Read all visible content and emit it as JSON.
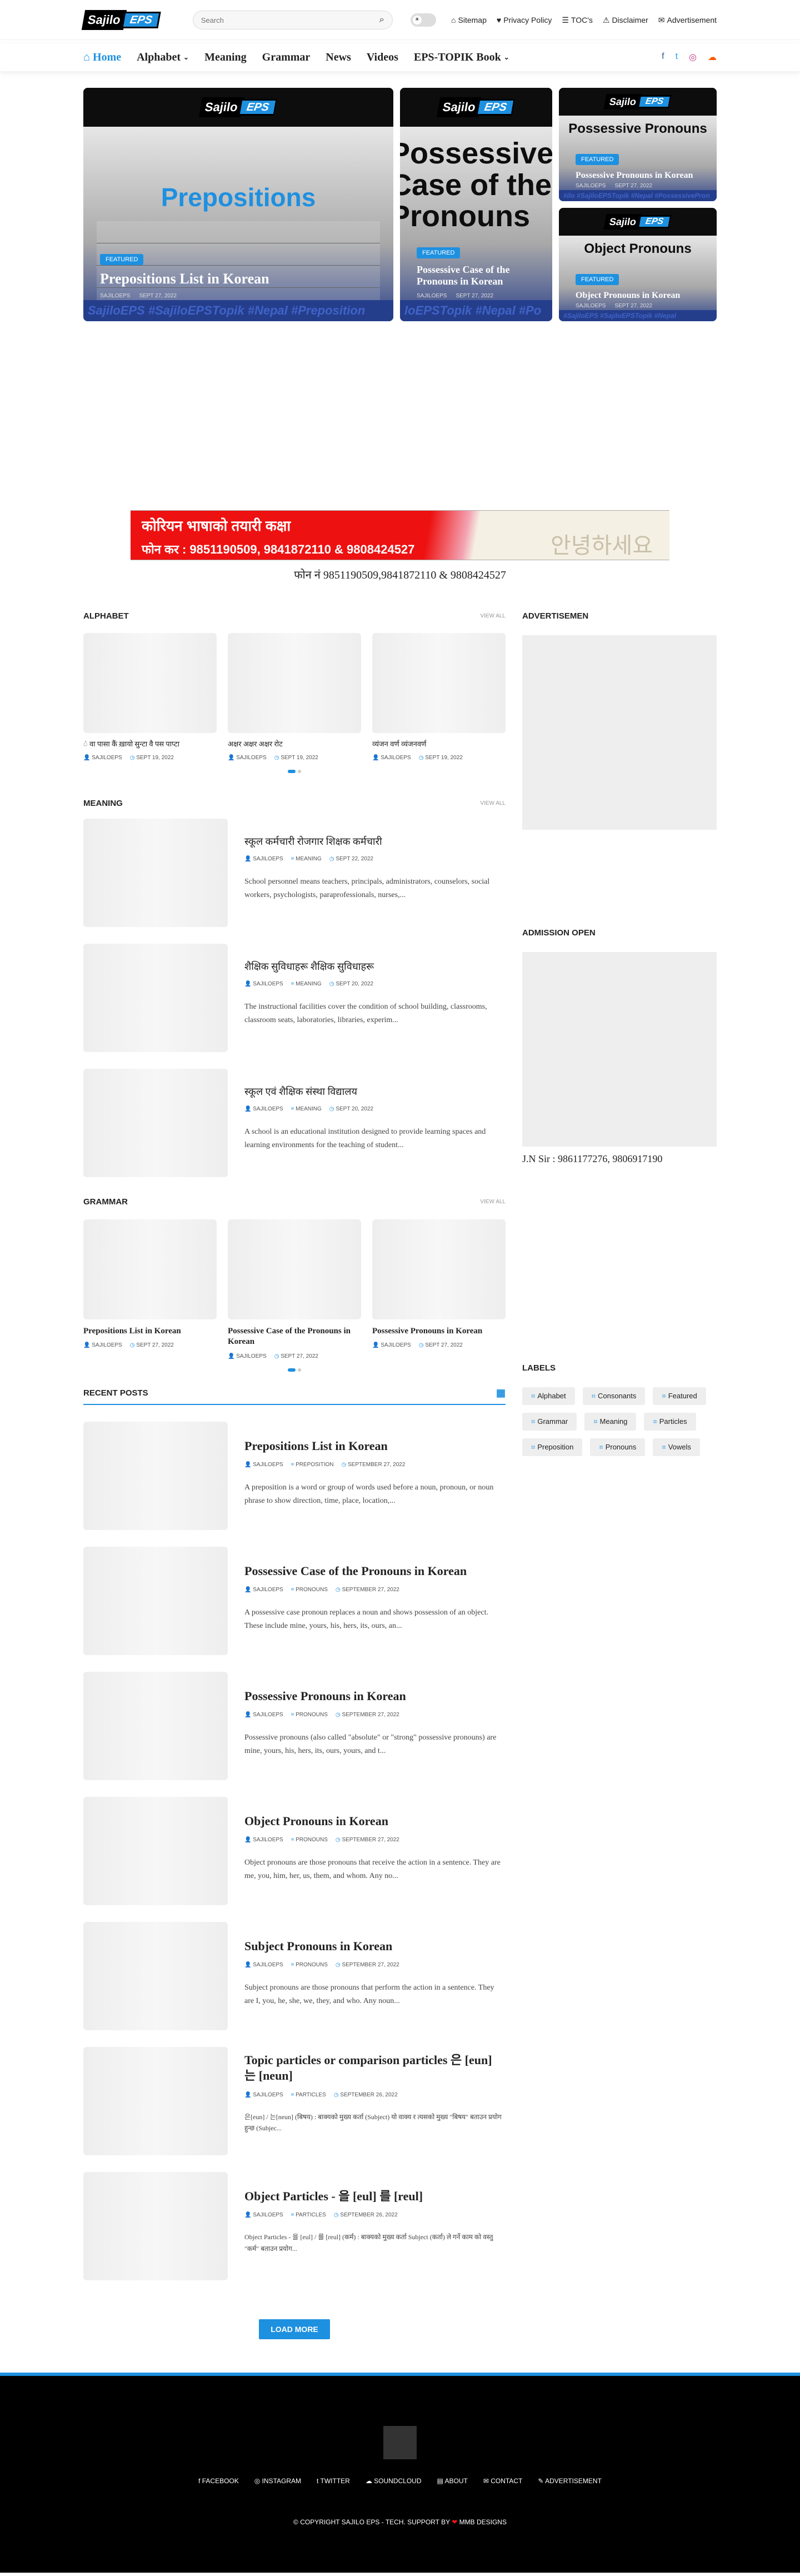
{
  "brand": {
    "part1": "Sajilo",
    "part2": "EPS"
  },
  "search": {
    "placeholder": "Search",
    "icon": "search-icon"
  },
  "toplinks": [
    "Sitemap",
    "Privacy Policy",
    "TOC's",
    "Disclaimer",
    "Advertisement"
  ],
  "nav": [
    {
      "label": "Home",
      "active": true
    },
    {
      "label": "Alphabet",
      "dropdown": true
    },
    {
      "label": "Meaning"
    },
    {
      "label": "Grammar"
    },
    {
      "label": "News"
    },
    {
      "label": "Videos"
    },
    {
      "label": "EPS-TOPIK Book",
      "dropdown": true
    }
  ],
  "social_icons": [
    "facebook-icon",
    "twitter-icon",
    "instagram-icon",
    "soundcloud-icon"
  ],
  "colors": {
    "accent": "#1e90e0",
    "dark": "#0d0d0d",
    "footer": "#000000"
  },
  "hero": [
    {
      "image_title": "Prepositions",
      "badge": "FEATURED",
      "title": "Prepositions List in Korean",
      "author": "SAJILOEPS",
      "date": "SEPT 27, 2022",
      "tags": "SajiloEPS #SajiloEPSTopik #Nepal #Preposition"
    },
    {
      "image_title": "Possessive Case of the Pronouns",
      "badge": "FEATURED",
      "title": "Possessive Case of the Pronouns in Korean",
      "author": "SAJILOEPS",
      "date": "SEPT 27, 2022",
      "tags": "loEPSTopik #Nepal #Po"
    },
    {
      "image_title": "Possessive Pronouns",
      "badge": "FEATURED",
      "title": "Possessive Pronouns in Korean",
      "author": "SAJILOEPS",
      "date": "SEPT 27, 2022",
      "tags": "#ilo #SajiloEPSTopik #Nepal #PossessivePron"
    },
    {
      "image_title": "Object Pronouns",
      "badge": "FEATURED",
      "title": "Object Pronouns in Korean",
      "author": "SAJILOEPS",
      "date": "SEPT 27, 2022",
      "tags": "#SajiloEPS #SajiloEPSTopik #Nepal"
    }
  ],
  "ad": {
    "line1": "कोरियन भाषाको तयारी कक्षा",
    "line2": "फोन कर : 9851190509, 9841872110 & 9808424527",
    "line3": "안녕하세요",
    "caption": "फोन नं 9851190509,9841872110 & 9808424527"
  },
  "alphabet": {
    "title": "ALPHABET",
    "view_all": "VIEW ALL",
    "items": [
      {
        "title": "ं वा पासा कैं ख़ायो सुन्टा वै पस पाप्टा",
        "author": "SAJILOEPS",
        "date": "SEPT 19, 2022"
      },
      {
        "title": "अक्षर अक्षर अक्षर रोट",
        "author": "SAJILOEPS",
        "date": "SEPT 19, 2022"
      },
      {
        "title": "व्यंजन वर्ण व्यंजनवर्ण",
        "author": "SAJILOEPS",
        "date": "SEPT 19, 2022"
      }
    ]
  },
  "meaning": {
    "title": "MEANING",
    "view_all": "VIEW ALL",
    "items": [
      {
        "title": "स्कूल कर्मचारी रोजगार शिक्षक कर्मचारी",
        "author": "SAJILOEPS",
        "label": "MEANING",
        "date": "SEPT 22, 2022",
        "excerpt": "School personnel means teachers, principals, administrators, counselors, social workers, psychologists, paraprofessionals, nurses,..."
      },
      {
        "title": "शैक्षिक सुविधाहरू शैक्षिक सुविधाहरू",
        "author": "SAJILOEPS",
        "label": "MEANING",
        "date": "SEPT 20, 2022",
        "excerpt": "The instructional facilities cover the condition of school building, classrooms, classroom seats, laboratories, libraries, experim..."
      },
      {
        "title": "स्कूल एवं शैक्षिक संस्था विद्यालय",
        "author": "SAJILOEPS",
        "label": "MEANING",
        "date": "SEPT 20, 2022",
        "excerpt": "A school is an educational institution designed to provide learning spaces and learning environments for the teaching of student..."
      }
    ]
  },
  "grammar": {
    "title": "GRAMMAR",
    "view_all": "VIEW ALL",
    "items": [
      {
        "title": "Prepositions List in Korean",
        "author": "SAJILOEPS",
        "date": "SEPT 27, 2022"
      },
      {
        "title": "Possessive Case of the Pronouns in Korean",
        "author": "SAJILOEPS",
        "date": "SEPT 27, 2022"
      },
      {
        "title": "Possessive Pronouns in Korean",
        "author": "SAJILOEPS",
        "date": "SEPT 27, 2022"
      }
    ]
  },
  "recent": {
    "title": "RECENT POSTS",
    "items": [
      {
        "title": "Prepositions List in Korean",
        "author": "SAJILOEPS",
        "label": "PREPOSITION",
        "date": "SEPTEMBER 27, 2022",
        "excerpt": "A preposition is a word or group of words used before a noun, pronoun, or noun phrase to show direction, time, place, location,..."
      },
      {
        "title": "Possessive Case of the Pronouns in Korean",
        "author": "SAJILOEPS",
        "label": "PRONOUNS",
        "date": "SEPTEMBER 27, 2022",
        "excerpt": "A possessive case pronoun replaces a noun and shows possession of an object. These include mine, yours, his, hers, its, ours, an..."
      },
      {
        "title": "Possessive Pronouns in Korean",
        "author": "SAJILOEPS",
        "label": "PRONOUNS",
        "date": "SEPTEMBER 27, 2022",
        "excerpt": "Possessive pronouns (also called \"absolute\" or \"strong\" possessive pronouns) are mine, yours, his, hers, its, ours, yours, and t..."
      },
      {
        "title": "Object Pronouns in Korean",
        "author": "SAJILOEPS",
        "label": "PRONOUNS",
        "date": "SEPTEMBER 27, 2022",
        "excerpt": "Object pronouns are those pronouns that receive the action in a sentence. They are me, you, him, her, us, them, and whom. Any no..."
      },
      {
        "title": "Subject Pronouns in Korean",
        "author": "SAJILOEPS",
        "label": "PRONOUNS",
        "date": "SEPTEMBER 27, 2022",
        "excerpt": "Subject pronouns are those pronouns that perform the action in a sentence. They are I, you, he, she, we, they, and who. Any noun..."
      },
      {
        "title": "Topic particles or comparison particles 은 [eun] 는 [neun]",
        "author": "SAJILOEPS",
        "label": "PARTICLES",
        "date": "SEPTEMBER 26, 2022",
        "excerpt": "은[eun] / 는[neun] (बिषय) : बाक्यको मुख्य कर्ता (Subject) यो वाक्य र त्यसको मुख्य \"बिषय\" बताउन प्रयोग हुन्छ (Subjec..."
      },
      {
        "title": "Object Particles - 을 [eul] 를 [reul]",
        "author": "SAJILOEPS",
        "label": "PARTICLES",
        "date": "SEPTEMBER 26, 2022",
        "excerpt": "Object Particles - 을 [eul] / 를 [reul] (कर्म) : बाक्यको मुख्य कर्ता Subject (कर्ता) ले गर्ने काम को वस्तु \"कर्म\" बताउन प्रयोग..."
      }
    ],
    "load_more": "LOAD MORE"
  },
  "sidebar": {
    "ad_title": "ADVERTISEMEN",
    "admission_title": "ADMISSION OPEN",
    "contact": "J.N Sir : 9861177276, 9806917190",
    "labels_title": "LABELS",
    "labels": [
      "Alphabet",
      "Consonants",
      "Featured",
      "Grammar",
      "Meaning",
      "Particles",
      "Preposition",
      "Pronouns",
      "Vowels"
    ]
  },
  "footer": {
    "links": [
      "FACEBOOK",
      "INSTAGRAM",
      "TWITTER",
      "SOUNDCLOUD",
      "ABOUT",
      "CONTACT",
      "ADVERTISEMENT"
    ],
    "copy_prefix": "© COPYRIGHT SAJILO EPS - TECH. SUPPORT BY",
    "heart": "❤",
    "copy_suffix": "MMB DESIGNS"
  }
}
